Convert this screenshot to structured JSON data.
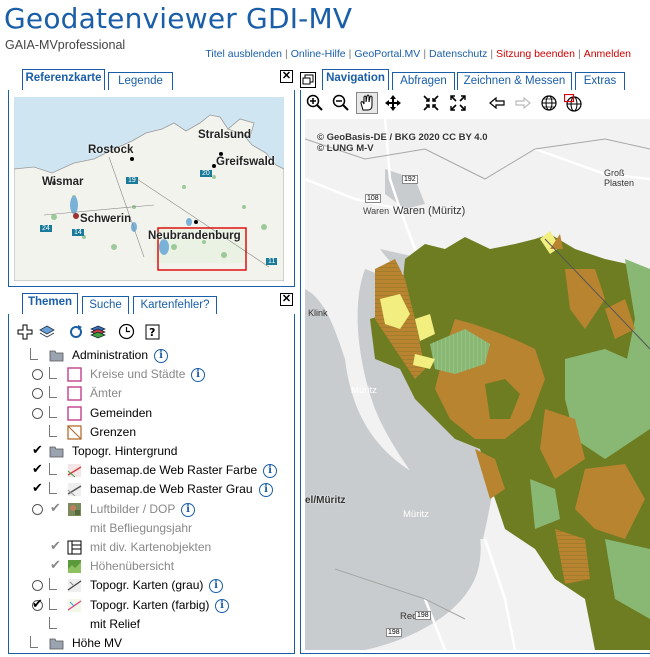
{
  "header": {
    "title": "Geodatenviewer GDI-MV",
    "subtitle": "GAIA-MVprofessional",
    "links": [
      {
        "label": "Titel ausblenden",
        "red": false
      },
      {
        "label": "Online-Hilfe",
        "red": false
      },
      {
        "label": "GeoPortal.MV",
        "red": false
      },
      {
        "label": "Datenschutz",
        "red": false
      },
      {
        "label": "Sitzung beenden",
        "red": true
      },
      {
        "label": "Anmelden",
        "red": true
      }
    ]
  },
  "left_top_tabs": {
    "referenzkarte": "Referenzkarte",
    "legende": "Legende"
  },
  "left_bottom_tabs": {
    "themen": "Themen",
    "suche": "Suche",
    "kartenfehler": "Kartenfehler?"
  },
  "close_glyph": "✕",
  "ref_map": {
    "cities": [
      "Stralsund",
      "Rostock",
      "Greifswald",
      "Wismar",
      "Schwerin",
      "Neubrandenburg"
    ],
    "shields": [
      "19",
      "20",
      "24",
      "14",
      "11"
    ]
  },
  "themes": [
    {
      "label": "Administration",
      "radio": false,
      "check": "none",
      "tree": true,
      "icon": "folder-icon",
      "info": true,
      "gray": false,
      "indent": 0
    },
    {
      "label": "Kreise und Städte",
      "radio": true,
      "check": "none",
      "tree": true,
      "icon": "pink-square-icon",
      "info": true,
      "gray": true,
      "indent": 1
    },
    {
      "label": "Ämter",
      "radio": true,
      "check": "none",
      "tree": true,
      "icon": "pink-square-icon",
      "info": false,
      "gray": true,
      "indent": 1
    },
    {
      "label": "Gemeinden",
      "radio": true,
      "check": "none",
      "tree": true,
      "icon": "pink-square-icon",
      "info": false,
      "gray": false,
      "indent": 1
    },
    {
      "label": "Grenzen",
      "radio": false,
      "check": "none",
      "tree": true,
      "icon": "boundary-icon",
      "info": false,
      "gray": false,
      "indent": 1
    },
    {
      "label": "Topogr. Hintergrund",
      "radio": false,
      "check": "checked",
      "tree": false,
      "icon": "folder-icon",
      "info": false,
      "gray": false,
      "indent": 0
    },
    {
      "label": "basemap.de Web Raster Farbe",
      "radio": false,
      "check": "checked",
      "tree": true,
      "icon": "basemap-color-icon",
      "info": true,
      "gray": false,
      "indent": 1
    },
    {
      "label": "basemap.de Web Raster Grau",
      "radio": false,
      "check": "checked",
      "tree": true,
      "icon": "basemap-gray-icon",
      "info": true,
      "gray": false,
      "indent": 1
    },
    {
      "label": "Luftbilder / DOP",
      "radio": true,
      "check": "gray",
      "tree": true,
      "icon": "aerial-icon",
      "info": true,
      "gray": true,
      "indent": 1
    },
    {
      "label": "mit Befliegungsjahr",
      "radio": false,
      "check": "none",
      "tree": false,
      "icon": "",
      "info": false,
      "gray": true,
      "indent": 2
    },
    {
      "label": "mit div. Kartenobjekten",
      "radio": false,
      "check": "gray",
      "tree": true,
      "icon": "grid-icon",
      "info": false,
      "gray": true,
      "indent": 2
    },
    {
      "label": "Höhenübersicht",
      "radio": false,
      "check": "gray",
      "tree": true,
      "icon": "relief-icon",
      "info": false,
      "gray": true,
      "indent": 2
    },
    {
      "label": "Topogr. Karten (grau)",
      "radio": true,
      "check": "none",
      "tree": true,
      "icon": "topo-gray-icon",
      "info": true,
      "gray": false,
      "indent": 1
    },
    {
      "label": "Topogr. Karten (farbig)",
      "radio": true,
      "check": "checked",
      "tree": true,
      "icon": "topo-color-icon",
      "info": true,
      "gray": false,
      "indent": 1
    },
    {
      "label": "mit Relief",
      "radio": false,
      "check": "none",
      "tree": true,
      "icon": "",
      "info": false,
      "gray": false,
      "indent": 2
    },
    {
      "label": "Höhe MV",
      "radio": false,
      "check": "none",
      "tree": true,
      "icon": "folder-icon",
      "info": false,
      "gray": false,
      "indent": 0
    }
  ],
  "right_tabs": {
    "navigation": "Navigation",
    "abfragen": "Abfragen",
    "zeichnen": "Zeichnen & Messen",
    "extras": "Extras"
  },
  "map": {
    "attribution1": "© GeoBasis-DE / BKG 2020 CC BY 4.0",
    "attribution2": "© LUNG M-V",
    "labels": {
      "waren_small": "Waren",
      "waren": "Waren (Müritz)",
      "gross": "Groß Plasten",
      "klink": "Klink",
      "mueritz": "Müritz",
      "mueritz2": "Müritz",
      "mueritz_left": "el/Müritz",
      "rechlin": "Rechlin"
    },
    "road_shields": [
      "108",
      "192",
      "198",
      "198"
    ]
  }
}
